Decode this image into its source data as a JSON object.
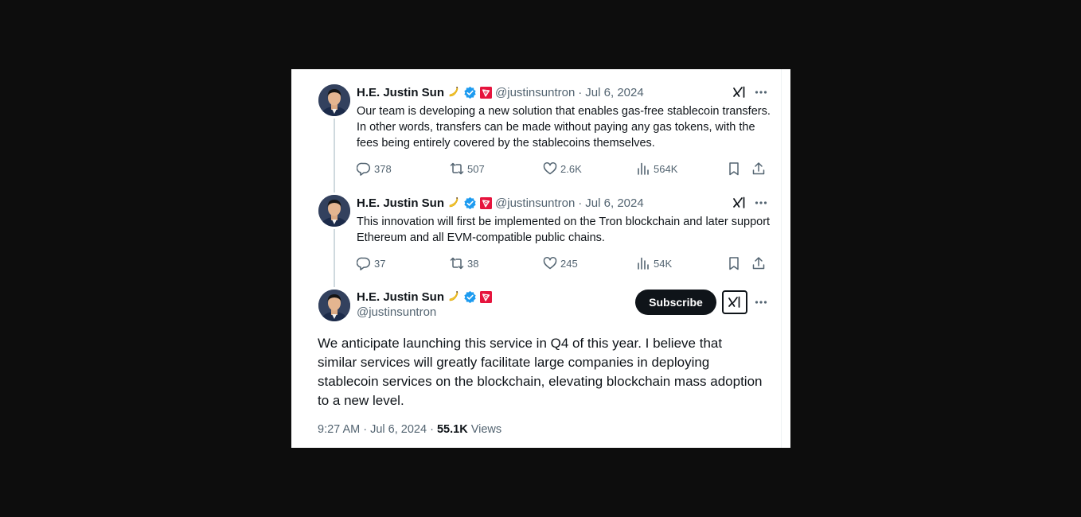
{
  "author": {
    "name": "H.E. Justin Sun",
    "handle": "@justinsuntron",
    "emoji": "banana-emoji",
    "verified_color": "#1d9bf0",
    "affiliate_badge_color": "#e6143d"
  },
  "separator": "·",
  "tweets": [
    {
      "date": "Jul 6, 2024",
      "text": "Our team is developing a new solution that enables gas-free stablecoin transfers. In other words, transfers can be made without paying any gas tokens, with the fees being entirely covered by the stablecoins themselves.",
      "replies": "378",
      "reposts": "507",
      "likes": "2.6K",
      "views": "564K"
    },
    {
      "date": "Jul 6, 2024",
      "text": "This innovation will first be implemented on the Tron blockchain and later support Ethereum and all EVM-compatible public chains.",
      "replies": "37",
      "reposts": "38",
      "likes": "245",
      "views": "54K"
    }
  ],
  "main_tweet": {
    "subscribe_label": "Subscribe",
    "text": "We anticipate launching this service in Q4 of this year. I believe that similar services will greatly facilitate large companies in deploying stablecoin services on the blockchain, elevating blockchain mass adoption to a new level.",
    "time": "9:27 AM",
    "date": "Jul 6, 2024",
    "views_count": "55.1K",
    "views_label": "Views"
  },
  "icons": [
    "grok-icon",
    "more-icon",
    "reply-icon",
    "repost-icon",
    "like-icon",
    "views-icon",
    "bookmark-icon",
    "share-icon"
  ]
}
